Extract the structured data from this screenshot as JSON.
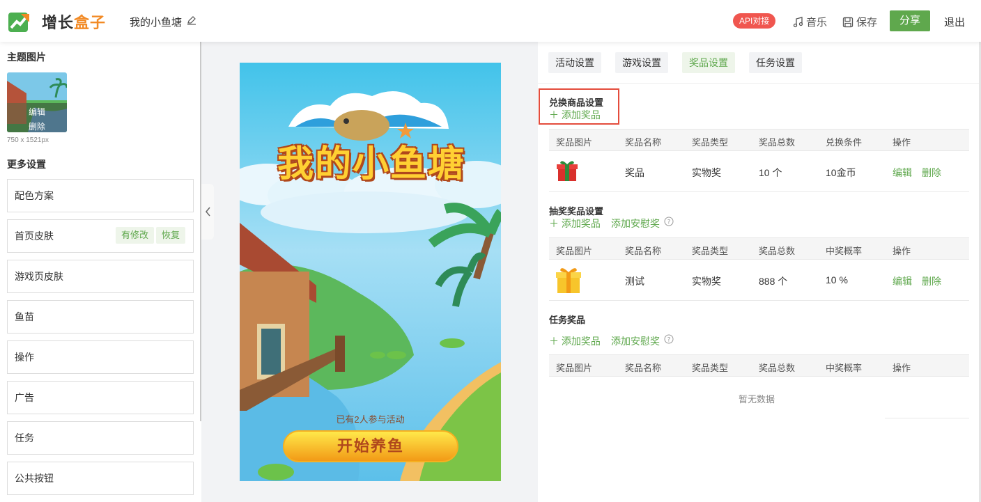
{
  "header": {
    "logo_dark": "增长",
    "logo_orange": "盒子",
    "project_title": "我的小鱼塘",
    "api_badge": "API对接",
    "music": "音乐",
    "save": "保存",
    "share": "分享",
    "logout": "退出"
  },
  "left": {
    "theme_title": "主题图片",
    "thumb_edit": "编辑",
    "thumb_delete": "删除",
    "thumb_size": "750 x 1521px",
    "more_title": "更多设置",
    "menu": [
      {
        "label": "配色方案"
      },
      {
        "label": "首页皮肤",
        "tag1": "有修改",
        "tag2": "恢复"
      },
      {
        "label": "游戏页皮肤"
      },
      {
        "label": "鱼苗"
      },
      {
        "label": "操作"
      },
      {
        "label": "广告"
      },
      {
        "label": "任务"
      },
      {
        "label": "公共按钮"
      }
    ]
  },
  "preview": {
    "game_title": "我的小鱼塘",
    "participants": "已有2人参与活动",
    "start_button": "开始养鱼"
  },
  "tabs": [
    "活动设置",
    "游戏设置",
    "奖品设置",
    "任务设置"
  ],
  "active_tab": "奖品设置",
  "exchange": {
    "title": "兑换商品设置",
    "add": "添加奖品",
    "headers": [
      "奖品图片",
      "奖品名称",
      "奖品类型",
      "奖品总数",
      "兑换条件",
      "操作"
    ],
    "row": {
      "name": "奖品",
      "type": "实物奖",
      "total": "10 个",
      "condition": "10金币",
      "edit": "编辑",
      "delete": "删除"
    }
  },
  "lottery": {
    "title": "抽奖奖品设置",
    "add": "添加奖品",
    "add_consolation": "添加安慰奖",
    "headers": [
      "奖品图片",
      "奖品名称",
      "奖品类型",
      "奖品总数",
      "中奖概率",
      "操作"
    ],
    "row": {
      "name": "测试",
      "type": "实物奖",
      "total": "888 个",
      "rate": "10 %",
      "edit": "编辑",
      "delete": "删除"
    }
  },
  "task": {
    "title": "任务奖品",
    "add": "添加奖品",
    "add_consolation": "添加安慰奖",
    "headers": [
      "奖品图片",
      "奖品名称",
      "奖品类型",
      "奖品总数",
      "中奖概率",
      "操作"
    ],
    "empty": "暂无数据"
  },
  "colors": {
    "accent_green": "#5fa84d",
    "badge_red": "#f0564f",
    "highlight_red": "#e44c3c",
    "logo_orange": "#f28a25"
  }
}
